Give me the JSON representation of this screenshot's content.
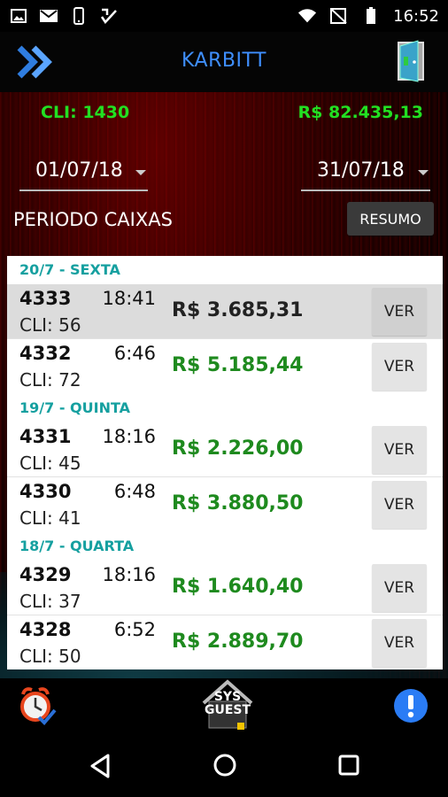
{
  "status_bar": {
    "time": "16:52",
    "left_icons": [
      "image-icon",
      "gmail-icon",
      "phone-icon",
      "check-app-icon"
    ],
    "right_icons": [
      "wifi-icon",
      "no-signal-icon",
      "battery-icon"
    ]
  },
  "header": {
    "title": "KARBITT",
    "menu_icon": "double-chevron-icon",
    "exit_icon": "door-icon"
  },
  "summary": {
    "cli_total": "CLI:  1430",
    "value_total": "R$ 82.435,13"
  },
  "filters": {
    "date_start": "01/07/18",
    "date_end": "31/07/18",
    "period_label": "PERIODO CAIXAS",
    "resumo_label": "RESUMO"
  },
  "list": {
    "groups": [
      {
        "header": "20/7 - SEXTA",
        "rows": [
          {
            "num": "4333",
            "time": "18:41",
            "cli": "CLI:  56",
            "amount": "R$ 3.685,31",
            "ver": "VER",
            "highlight": true
          },
          {
            "num": "4332",
            "time": "6:46",
            "cli": "CLI:  72",
            "amount": "R$ 5.185,44",
            "ver": "VER",
            "highlight": false
          }
        ]
      },
      {
        "header": "19/7 - QUINTA",
        "rows": [
          {
            "num": "4331",
            "time": "18:16",
            "cli": "CLI:  45",
            "amount": "R$ 2.226,00",
            "ver": "VER",
            "highlight": false
          },
          {
            "num": "4330",
            "time": "6:48",
            "cli": "CLI:  41",
            "amount": "R$ 3.880,50",
            "ver": "VER",
            "highlight": false
          }
        ]
      },
      {
        "header": "18/7 - QUARTA",
        "rows": [
          {
            "num": "4329",
            "time": "18:16",
            "cli": "CLI:  37",
            "amount": "R$ 1.640,40",
            "ver": "VER",
            "highlight": false
          },
          {
            "num": "4328",
            "time": "6:52",
            "cli": "CLI:  50",
            "amount": "R$ 2.889,70",
            "ver": "VER",
            "highlight": false
          }
        ]
      }
    ]
  },
  "toolbar": {
    "alarm_icon": "alarm-clock-icon",
    "guest_label_top": "SYS",
    "guest_label_bottom": "GUEST",
    "alert_icon": "exclamation-icon"
  },
  "colors": {
    "title_blue": "#3f8fff",
    "green_total": "#22e022",
    "amount_green": "#1e8a1e",
    "group_teal": "#16a0a0"
  }
}
